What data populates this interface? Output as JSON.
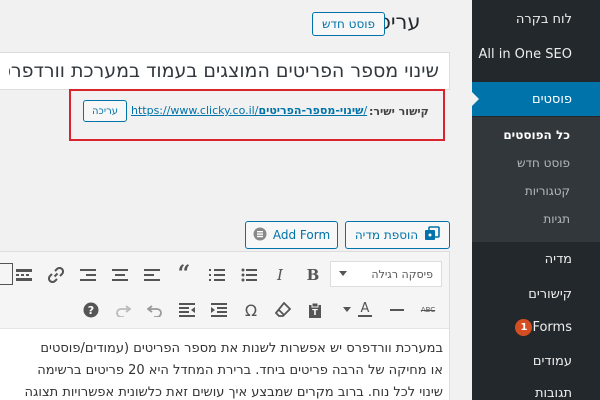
{
  "sidebar": {
    "items": [
      {
        "label": "לוח בקרה"
      },
      {
        "label": "All in One SEO"
      },
      {
        "label": "פוסטים"
      },
      {
        "label": "מדיה"
      },
      {
        "label": "קישורים"
      },
      {
        "label": "Forms",
        "badge": "1"
      },
      {
        "label": "עמודים"
      },
      {
        "label": "תגובות"
      }
    ],
    "submenu": [
      {
        "label": "כל הפוסטים"
      },
      {
        "label": "פוסט חדש"
      },
      {
        "label": "קטגוריות"
      },
      {
        "label": "תגיות"
      }
    ]
  },
  "header": {
    "title": "עריכה",
    "new_post_label": "פוסט חדש"
  },
  "post": {
    "title": "שינוי מספר הפריטים המוצגים בעמוד במערכת וורדפרס"
  },
  "permalink": {
    "label": "קישור ישיר:",
    "base": "https://www.clicky.co.il/",
    "slug": "שינוי-מספר-הפריטים",
    "tail": "/",
    "edit_label": "עריכה"
  },
  "media": {
    "add_media_label": "הוספת מדיה",
    "add_form_label": "Add Form"
  },
  "toolbar": {
    "format_select": "פיסקה רגילה"
  },
  "content": {
    "line1": "במערכת וורדפרס יש אפשרות לשנות את מספר הפריטים (עמודים/פוסטים",
    "line2": "או מחיקה של הרבה פריטים ביחד. ברירת המחדל היא 20 פריטים ברשימה",
    "line3": "שינוי לכל נוח. ברוב מקרים שמבצע איך עושים זאת כלשונית אפשרויות תצוגה"
  },
  "colors": {
    "sidebar_bg": "#23282d",
    "active_menu": "#0073aa",
    "accent_blue": "#0073aa",
    "highlight_red": "#d9232d",
    "badge_orange": "#d54e21"
  }
}
